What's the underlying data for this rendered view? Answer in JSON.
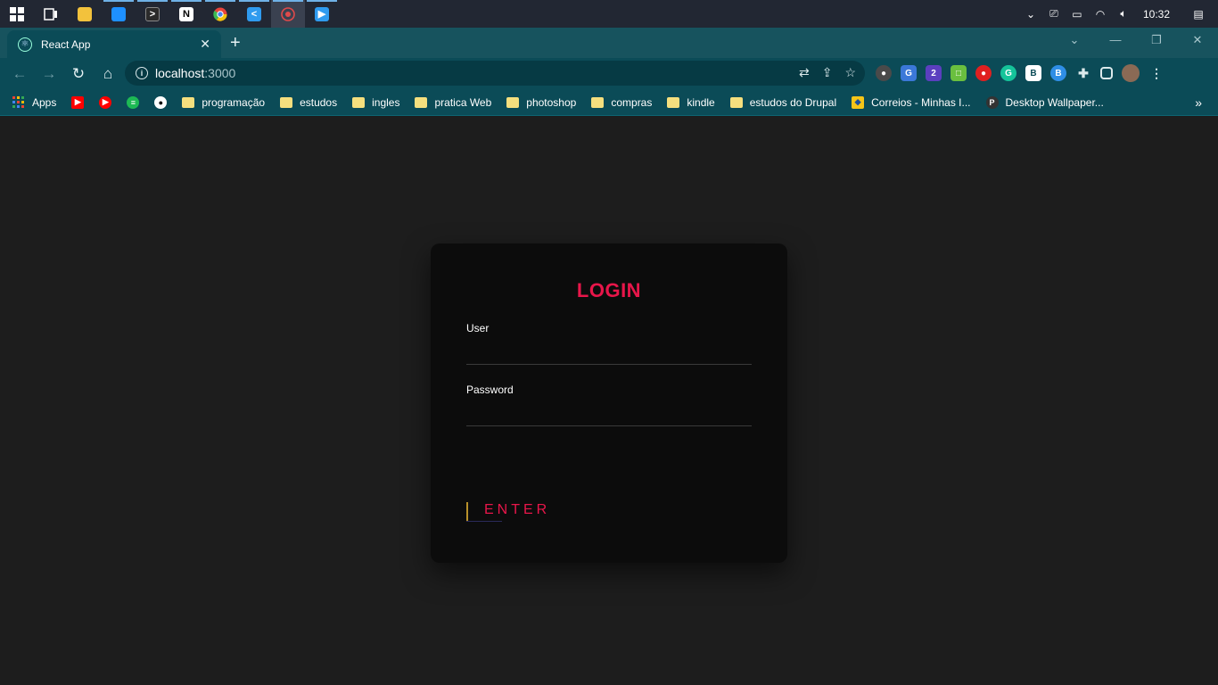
{
  "taskbar": {
    "icons": [
      {
        "name": "windows-start-icon",
        "color": "#ffffff"
      },
      {
        "name": "task-view-icon",
        "color": "#ffffff"
      },
      {
        "name": "file-explorer-icon",
        "color": "#f3c23c"
      },
      {
        "name": "store-icon",
        "color": "#1e90ff"
      },
      {
        "name": "terminal-icon",
        "color": "#2b2b2b"
      },
      {
        "name": "notion-icon",
        "color": "#ffffff"
      },
      {
        "name": "chrome-icon",
        "color": "#e8453c"
      },
      {
        "name": "vscode-icon",
        "color": "#2f9bef"
      },
      {
        "name": "record-icon",
        "color": "#e04a4a"
      },
      {
        "name": "photos-icon",
        "color": "#2f9bef"
      }
    ],
    "clock": "10:32"
  },
  "browser": {
    "tab_title": "React App",
    "new_tab": "+",
    "url_host": "localhost",
    "url_port": ":3000",
    "bookmarks": [
      {
        "label": "Apps",
        "type": "apps"
      },
      {
        "label": "",
        "type": "youtube",
        "color": "#ff0000"
      },
      {
        "label": "",
        "type": "youtube-music",
        "color": "#ff0000"
      },
      {
        "label": "",
        "type": "spotify",
        "color": "#1db954"
      },
      {
        "label": "",
        "type": "github",
        "color": "#ffffff"
      },
      {
        "label": "programação",
        "type": "folder"
      },
      {
        "label": "estudos",
        "type": "folder"
      },
      {
        "label": "ingles",
        "type": "folder"
      },
      {
        "label": "pratica Web",
        "type": "folder"
      },
      {
        "label": "photoshop",
        "type": "folder"
      },
      {
        "label": "compras",
        "type": "folder"
      },
      {
        "label": "kindle",
        "type": "folder"
      },
      {
        "label": "estudos do Drupal",
        "type": "folder"
      },
      {
        "label": "Correios - Minhas I...",
        "type": "site",
        "color": "#f5c518"
      },
      {
        "label": "Desktop Wallpaper...",
        "type": "site",
        "color": "#333333"
      }
    ]
  },
  "login": {
    "title": "LOGIN",
    "user_label": "User",
    "user_value": "",
    "password_label": "Password",
    "password_value": "",
    "submit_label": "ENTER"
  },
  "colors": {
    "accent": "#e8164a",
    "card_bg": "#0c0c0c",
    "page_bg": "#1d1d1d"
  }
}
